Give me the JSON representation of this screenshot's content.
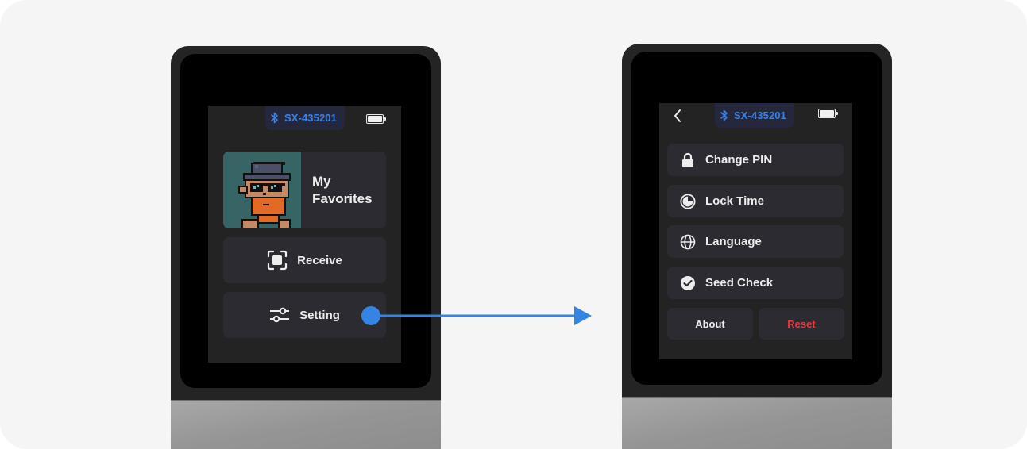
{
  "left_device": {
    "status": {
      "bluetooth_icon": "bluetooth-icon",
      "device_name": "SX-435201",
      "battery_icon": "battery-full-icon",
      "battery_level_percent": 100
    },
    "favorites": {
      "label_line1": "My",
      "label_line2": "Favorites",
      "avatar": "pixel-art-character-avatar"
    },
    "receive": {
      "icon": "scan-frame-icon",
      "label": "Receive"
    },
    "setting": {
      "icon": "sliders-icon",
      "label": "Setting"
    }
  },
  "right_device": {
    "status": {
      "back_icon": "chevron-left-icon",
      "bluetooth_icon": "bluetooth-icon",
      "device_name": "SX-435201",
      "battery_icon": "battery-full-icon",
      "battery_level_percent": 100
    },
    "menu": [
      {
        "icon": "lock-icon",
        "label": "Change PIN"
      },
      {
        "icon": "clock-icon",
        "label": "Lock Time"
      },
      {
        "icon": "globe-icon",
        "label": "Language"
      },
      {
        "icon": "check-circle-icon",
        "label": "Seed Check"
      }
    ],
    "about_label": "About",
    "reset_label": "Reset"
  },
  "colors": {
    "accent_blue": "#3b82e6",
    "reset_red": "#e8393f",
    "card_bg": "#2b2b31",
    "screen_bg": "#232323",
    "bt_pill_bg": "#25283d"
  },
  "flow_arrow": {
    "from": "setting",
    "to": "settings-screen"
  }
}
